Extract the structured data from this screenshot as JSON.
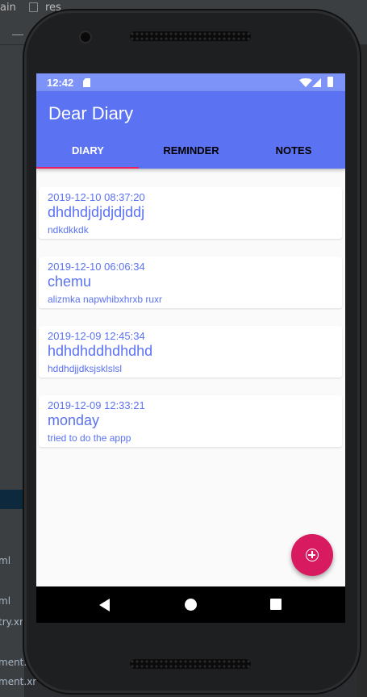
{
  "ide": {
    "crumb_left": "ain",
    "crumb_right": "res",
    "side_items": [
      "ml",
      "ml",
      "try.xr",
      "ment.xr",
      "ment.xr"
    ]
  },
  "status_bar": {
    "time": "12:42",
    "icons": [
      "sd-card-icon",
      "wifi-icon",
      "signal-icon",
      "battery-icon"
    ]
  },
  "app": {
    "title": "Dear Diary",
    "tabs": [
      {
        "label": "DIARY",
        "selected": true
      },
      {
        "label": "REMINDER",
        "selected": false
      },
      {
        "label": "NOTES",
        "selected": false
      }
    ]
  },
  "entries": [
    {
      "date": "2019-12-10 08:37:20",
      "title": "dhdhdjdjdjdjddj",
      "body": "ndkdkkdk"
    },
    {
      "date": "2019-12-10 06:06:34",
      "title": "chemu",
      "body": "alizmka napwhibxhrxb ruxr"
    },
    {
      "date": "2019-12-09 12:45:34",
      "title": "hdhdhddhdhdhd",
      "body": "hddhdjjdksjsklslsl"
    },
    {
      "date": "2019-12-09 12:33:21",
      "title": "monday",
      "body": "tried to do the appp"
    }
  ],
  "fab": {
    "icon": "add-circle-icon"
  },
  "nav": {
    "icons": [
      "back-icon",
      "home-icon",
      "recents-icon"
    ]
  },
  "colors": {
    "primary": "#5b72f2",
    "status_bar": "#7d93f7",
    "accent": "#e91e63",
    "fab": "#d81b60"
  }
}
